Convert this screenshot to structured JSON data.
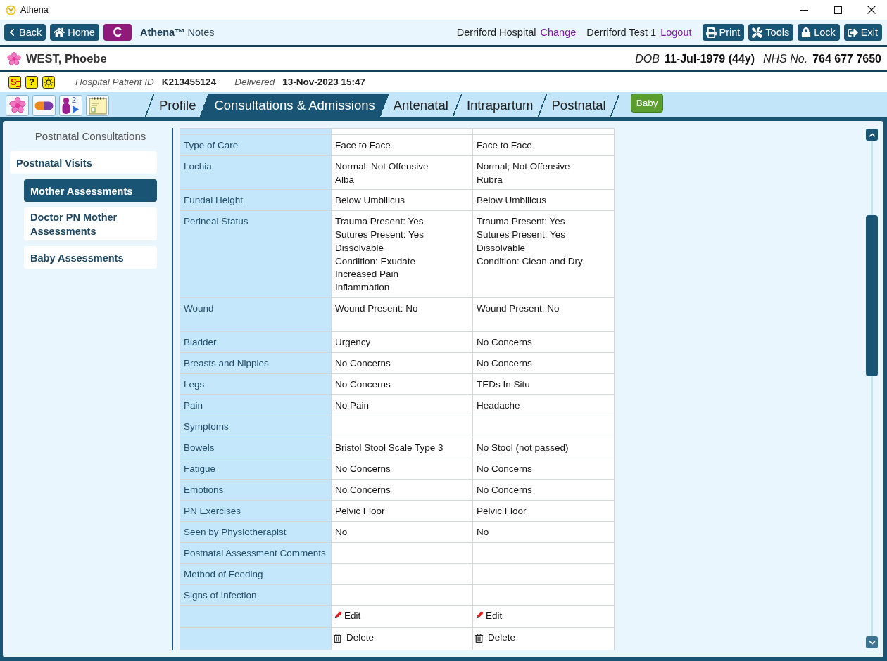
{
  "window": {
    "title": "Athena"
  },
  "toolbar": {
    "nav_buttons": [
      {
        "kind": "back",
        "label": "Back"
      },
      {
        "kind": "home",
        "label": "Home"
      }
    ],
    "module_button": "C",
    "app_title": "**Athena™** Notes",
    "location": "Derriford Hospital",
    "location_link": "Change",
    "user": "Derriford Test 1",
    "user_link": "Logout",
    "actions": [
      {
        "kind": "print",
        "label": "Print"
      },
      {
        "kind": "tools",
        "label": "Tools"
      },
      {
        "kind": "lock",
        "label": "Lock"
      },
      {
        "kind": "exit",
        "label": "Exit"
      }
    ]
  },
  "patient": {
    "name": "WEST, Phoebe",
    "dob_label": "DOB",
    "dob": "11-Jul-1979 (44y)",
    "nhs_label": "NHS No.",
    "nhs_number": "764 677 7650"
  },
  "info_bar": {
    "icons": [
      {
        "kind": "flag",
        "symbol": "S"
      },
      {
        "kind": "help",
        "symbol": "?"
      },
      {
        "kind": "sun"
      }
    ],
    "fields": [
      {
        "label": "Hospital Patient ID",
        "value": "K213455124"
      },
      {
        "label": "Delivered",
        "value": "13-Nov-2023 15:47"
      }
    ]
  },
  "nav": {
    "icon_buttons": [
      {
        "kind": "flower"
      },
      {
        "kind": "pill"
      },
      {
        "kind": "babies",
        "count": "2"
      },
      {
        "kind": "notepad"
      }
    ],
    "tabs": [
      {
        "label": "Profile",
        "selected": false
      },
      {
        "label": "Consultations & Admissions",
        "selected": true
      },
      {
        "label": "Antenatal",
        "selected": false
      },
      {
        "label": "Intrapartum",
        "selected": false
      },
      {
        "label": "Postnatal",
        "selected": false
      }
    ],
    "baby_button": "Baby"
  },
  "sidebar": {
    "heading": "Postnatal Consultations",
    "items": [
      {
        "label": "Postnatal Visits",
        "selected": false,
        "children": [
          {
            "label": "Mother Assessments",
            "selected": true
          },
          {
            "label": "Doctor PN Mother Assessments",
            "selected": false
          },
          {
            "label": "Baby Assessments",
            "selected": false
          }
        ]
      }
    ]
  },
  "table": {
    "rows": [
      {
        "label": "Type of Care",
        "values": [
          "Face to Face",
          "Face to Face"
        ]
      },
      {
        "label": "Lochia",
        "values": [
          "Normal; Not Offensive\nAlba",
          "Normal; Not Offensive\nRubra"
        ]
      },
      {
        "label": "Fundal Height",
        "values": [
          "Below Umbilicus",
          "Below Umbilicus"
        ]
      },
      {
        "label": "Perineal Status",
        "values": [
          "Trauma Present: Yes\nSutures Present: Yes\nDissolvable\nCondition: Exudate\nIncreased Pain\nInflammation",
          "Trauma Present: Yes\nSutures Present: Yes\nDissolvable\nCondition: Clean and Dry"
        ]
      },
      {
        "label": "Wound",
        "values": [
          "Wound Present: No",
          "Wound Present: No"
        ]
      },
      {
        "label": "Bladder",
        "values": [
          "Urgency",
          "No Concerns"
        ]
      },
      {
        "label": "Breasts and Nipples",
        "values": [
          "No Concerns",
          "No Concerns"
        ]
      },
      {
        "label": "Legs",
        "values": [
          "No Concerns",
          "TEDs In Situ"
        ]
      },
      {
        "label": "Pain",
        "values": [
          "No Pain",
          "Headache"
        ]
      },
      {
        "label": "Symptoms"
      },
      {
        "label": "Bowels",
        "values": [
          "Bristol Stool Scale Type 3",
          "No Stool (not passed)"
        ]
      },
      {
        "label": "Fatigue",
        "values": [
          "No Concerns",
          "No Concerns"
        ]
      },
      {
        "label": "Emotions",
        "values": [
          "No Concerns",
          "No Concerns"
        ]
      },
      {
        "label": "PN Exercises",
        "values": [
          "Pelvic Floor",
          "Pelvic Floor"
        ]
      },
      {
        "label": "Seen by Physiotherapist",
        "values": [
          "No",
          "No"
        ]
      },
      {
        "label": "Postnatal Assessment Comments"
      },
      {
        "label": "Method of Feeding"
      },
      {
        "label": "Signs of Infection"
      }
    ],
    "action_rows": [
      {
        "kind": "edit",
        "cells": [
          "Edit",
          "Edit"
        ]
      },
      {
        "kind": "delete",
        "cells": [
          "Delete",
          "Delete"
        ]
      }
    ]
  }
}
